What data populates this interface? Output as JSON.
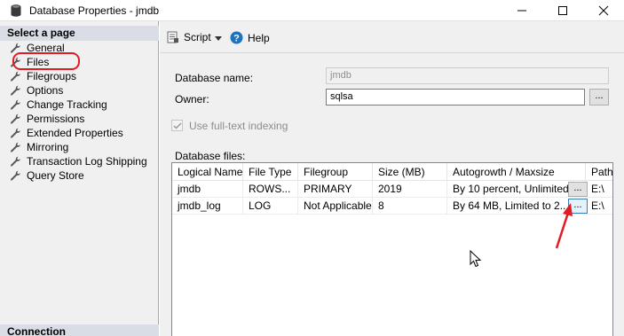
{
  "window": {
    "title": "Database Properties - jmdb"
  },
  "left_pane": {
    "select_page_header": "Select a page",
    "pages": [
      {
        "label": "General"
      },
      {
        "label": "Files"
      },
      {
        "label": "Filegroups"
      },
      {
        "label": "Options"
      },
      {
        "label": "Change Tracking"
      },
      {
        "label": "Permissions"
      },
      {
        "label": "Extended Properties"
      },
      {
        "label": "Mirroring"
      },
      {
        "label": "Transaction Log Shipping"
      },
      {
        "label": "Query Store"
      }
    ],
    "connection_header": "Connection"
  },
  "toolbar": {
    "script_label": "Script",
    "help_label": "Help"
  },
  "form": {
    "db_name_label": "Database name:",
    "db_name_value": "jmdb",
    "owner_label": "Owner:",
    "owner_value": "sqlsa",
    "owner_browse": "...",
    "fulltext_label": "Use full-text indexing",
    "fulltext_checked": true,
    "files_label": "Database files:"
  },
  "grid": {
    "columns": [
      "Logical Name",
      "File Type",
      "Filegroup",
      "Size (MB)",
      "Autogrowth / Maxsize",
      "Path"
    ],
    "rows": [
      {
        "logical": "jmdb",
        "type": "ROWS...",
        "group": "PRIMARY",
        "size": "2019",
        "auto": "By 10 percent, Unlimited",
        "button": "...",
        "path": "E:\\"
      },
      {
        "logical": "jmdb_log",
        "type": "LOG",
        "group": "Not Applicable",
        "size": "8",
        "auto": "By 64 MB, Limited to 2...",
        "button": "...",
        "path": "E:\\"
      }
    ]
  },
  "colors": {
    "highlight_red": "#e31b23",
    "help_blue": "#1e73be"
  }
}
